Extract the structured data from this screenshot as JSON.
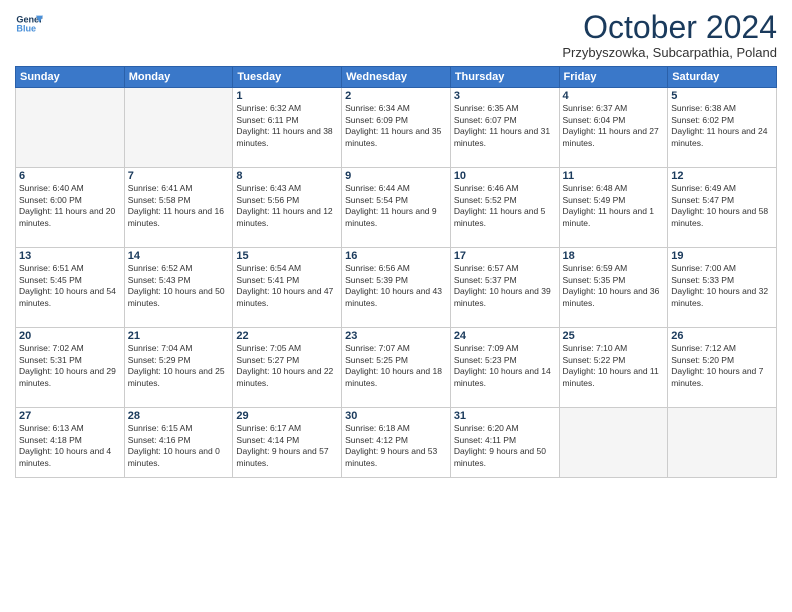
{
  "logo": {
    "line1": "General",
    "line2": "Blue"
  },
  "title": "October 2024",
  "location": "Przybyszowka, Subcarpathia, Poland",
  "weekdays": [
    "Sunday",
    "Monday",
    "Tuesday",
    "Wednesday",
    "Thursday",
    "Friday",
    "Saturday"
  ],
  "weeks": [
    [
      {
        "day": "",
        "info": ""
      },
      {
        "day": "",
        "info": ""
      },
      {
        "day": "1",
        "info": "Sunrise: 6:32 AM\nSunset: 6:11 PM\nDaylight: 11 hours and 38 minutes."
      },
      {
        "day": "2",
        "info": "Sunrise: 6:34 AM\nSunset: 6:09 PM\nDaylight: 11 hours and 35 minutes."
      },
      {
        "day": "3",
        "info": "Sunrise: 6:35 AM\nSunset: 6:07 PM\nDaylight: 11 hours and 31 minutes."
      },
      {
        "day": "4",
        "info": "Sunrise: 6:37 AM\nSunset: 6:04 PM\nDaylight: 11 hours and 27 minutes."
      },
      {
        "day": "5",
        "info": "Sunrise: 6:38 AM\nSunset: 6:02 PM\nDaylight: 11 hours and 24 minutes."
      }
    ],
    [
      {
        "day": "6",
        "info": "Sunrise: 6:40 AM\nSunset: 6:00 PM\nDaylight: 11 hours and 20 minutes."
      },
      {
        "day": "7",
        "info": "Sunrise: 6:41 AM\nSunset: 5:58 PM\nDaylight: 11 hours and 16 minutes."
      },
      {
        "day": "8",
        "info": "Sunrise: 6:43 AM\nSunset: 5:56 PM\nDaylight: 11 hours and 12 minutes."
      },
      {
        "day": "9",
        "info": "Sunrise: 6:44 AM\nSunset: 5:54 PM\nDaylight: 11 hours and 9 minutes."
      },
      {
        "day": "10",
        "info": "Sunrise: 6:46 AM\nSunset: 5:52 PM\nDaylight: 11 hours and 5 minutes."
      },
      {
        "day": "11",
        "info": "Sunrise: 6:48 AM\nSunset: 5:49 PM\nDaylight: 11 hours and 1 minute."
      },
      {
        "day": "12",
        "info": "Sunrise: 6:49 AM\nSunset: 5:47 PM\nDaylight: 10 hours and 58 minutes."
      }
    ],
    [
      {
        "day": "13",
        "info": "Sunrise: 6:51 AM\nSunset: 5:45 PM\nDaylight: 10 hours and 54 minutes."
      },
      {
        "day": "14",
        "info": "Sunrise: 6:52 AM\nSunset: 5:43 PM\nDaylight: 10 hours and 50 minutes."
      },
      {
        "day": "15",
        "info": "Sunrise: 6:54 AM\nSunset: 5:41 PM\nDaylight: 10 hours and 47 minutes."
      },
      {
        "day": "16",
        "info": "Sunrise: 6:56 AM\nSunset: 5:39 PM\nDaylight: 10 hours and 43 minutes."
      },
      {
        "day": "17",
        "info": "Sunrise: 6:57 AM\nSunset: 5:37 PM\nDaylight: 10 hours and 39 minutes."
      },
      {
        "day": "18",
        "info": "Sunrise: 6:59 AM\nSunset: 5:35 PM\nDaylight: 10 hours and 36 minutes."
      },
      {
        "day": "19",
        "info": "Sunrise: 7:00 AM\nSunset: 5:33 PM\nDaylight: 10 hours and 32 minutes."
      }
    ],
    [
      {
        "day": "20",
        "info": "Sunrise: 7:02 AM\nSunset: 5:31 PM\nDaylight: 10 hours and 29 minutes."
      },
      {
        "day": "21",
        "info": "Sunrise: 7:04 AM\nSunset: 5:29 PM\nDaylight: 10 hours and 25 minutes."
      },
      {
        "day": "22",
        "info": "Sunrise: 7:05 AM\nSunset: 5:27 PM\nDaylight: 10 hours and 22 minutes."
      },
      {
        "day": "23",
        "info": "Sunrise: 7:07 AM\nSunset: 5:25 PM\nDaylight: 10 hours and 18 minutes."
      },
      {
        "day": "24",
        "info": "Sunrise: 7:09 AM\nSunset: 5:23 PM\nDaylight: 10 hours and 14 minutes."
      },
      {
        "day": "25",
        "info": "Sunrise: 7:10 AM\nSunset: 5:22 PM\nDaylight: 10 hours and 11 minutes."
      },
      {
        "day": "26",
        "info": "Sunrise: 7:12 AM\nSunset: 5:20 PM\nDaylight: 10 hours and 7 minutes."
      }
    ],
    [
      {
        "day": "27",
        "info": "Sunrise: 6:13 AM\nSunset: 4:18 PM\nDaylight: 10 hours and 4 minutes."
      },
      {
        "day": "28",
        "info": "Sunrise: 6:15 AM\nSunset: 4:16 PM\nDaylight: 10 hours and 0 minutes."
      },
      {
        "day": "29",
        "info": "Sunrise: 6:17 AM\nSunset: 4:14 PM\nDaylight: 9 hours and 57 minutes."
      },
      {
        "day": "30",
        "info": "Sunrise: 6:18 AM\nSunset: 4:12 PM\nDaylight: 9 hours and 53 minutes."
      },
      {
        "day": "31",
        "info": "Sunrise: 6:20 AM\nSunset: 4:11 PM\nDaylight: 9 hours and 50 minutes."
      },
      {
        "day": "",
        "info": ""
      },
      {
        "day": "",
        "info": ""
      }
    ]
  ]
}
